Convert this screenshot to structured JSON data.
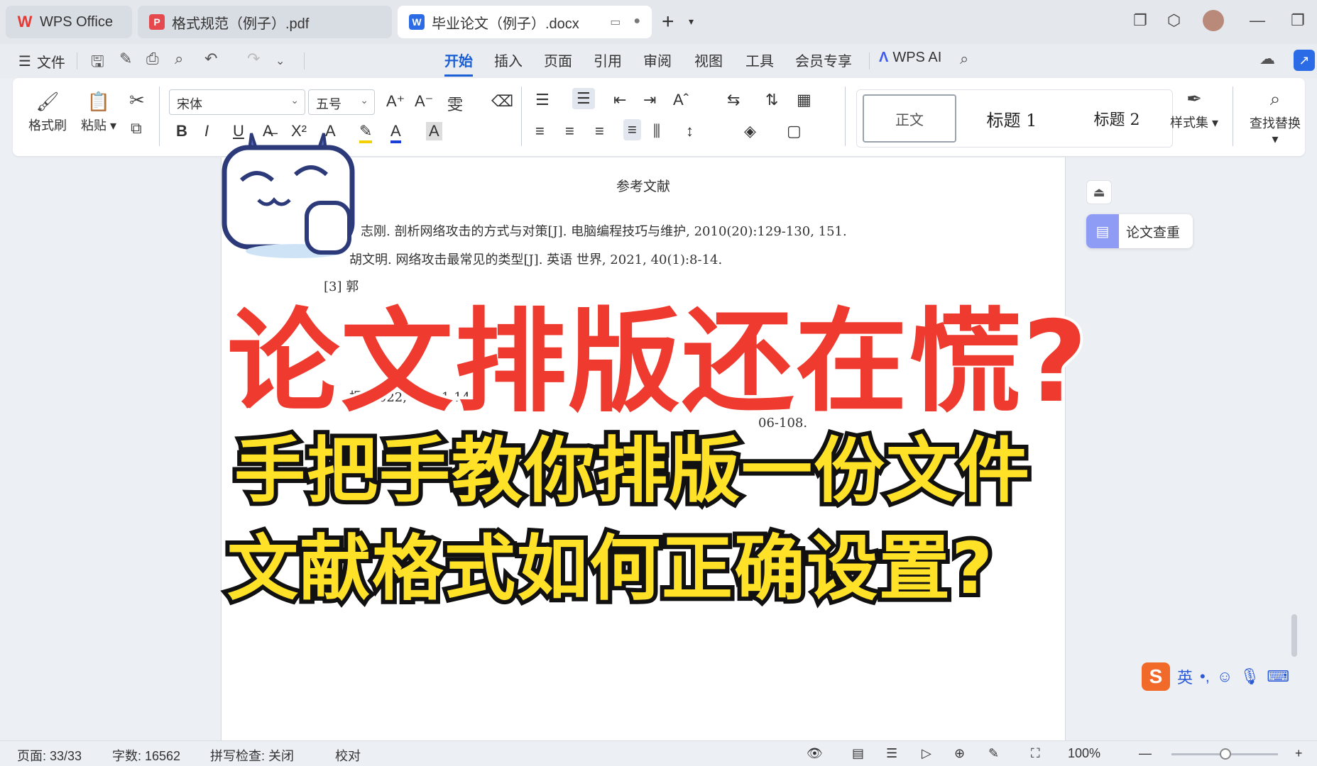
{
  "tabs": {
    "home": "WPS Office",
    "pdf": "格式规范（例子）.pdf",
    "doc": "毕业论文（例子）.docx"
  },
  "menu": {
    "file": "文件",
    "items": [
      "开始",
      "插入",
      "页面",
      "引用",
      "审阅",
      "视图",
      "工具",
      "会员专享"
    ],
    "wps_ai": "WPS AI"
  },
  "ribbon": {
    "format_painter": "格式刷",
    "paste": "粘贴",
    "font_name": "宋体",
    "font_size": "五号",
    "styles": [
      "正文",
      "标题 1",
      "标题 2"
    ],
    "style_set": "样式集",
    "find_replace": "查找替换"
  },
  "document": {
    "heading": "参考文献",
    "refs": [
      "志刚. 剖析网络攻击的方式与对策[J]. 电脑编程技巧与维护, 2010(20):129-130, 151.",
      "胡文明. 网络攻击最常见的类型[J]. 英语  世界, 2021, 40(1):8-14.",
      "[3] 郭",
      "报, 2022, 8(1):1-14.",
      "06-108."
    ]
  },
  "side_panel": {
    "paper_check": "论文查重"
  },
  "ime": {
    "mode": "英"
  },
  "status": {
    "page": "页面: 33/33",
    "words": "字数: 16562",
    "spell": "拼写检查: 关闭",
    "proof": "校对",
    "zoom": "100%"
  },
  "overlay": {
    "line1": "论文排版还在慌?",
    "line2": "手把手教你排版一份文件",
    "line3": "文献格式如何正确设置?"
  },
  "colors": {
    "accent": "#1b5fd6",
    "headline_red": "#ef3b2f",
    "headline_yellow": "#ffe227"
  }
}
